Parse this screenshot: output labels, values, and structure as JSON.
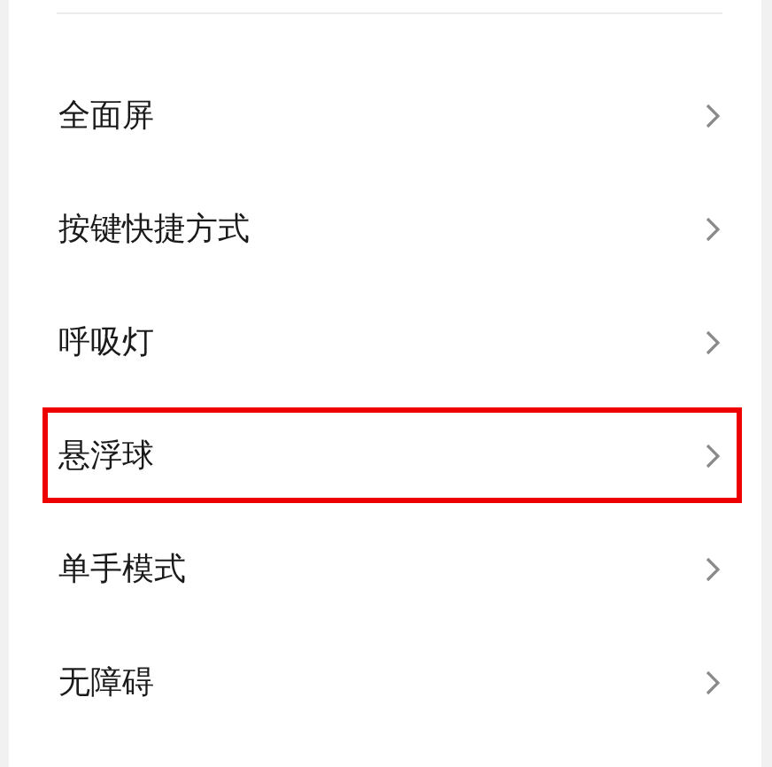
{
  "settings_list": [
    {
      "label": "全面屏",
      "highlighted": false
    },
    {
      "label": "按键快捷方式",
      "highlighted": false
    },
    {
      "label": "呼吸灯",
      "highlighted": false
    },
    {
      "label": "悬浮球",
      "highlighted": true
    },
    {
      "label": "单手模式",
      "highlighted": false
    },
    {
      "label": "无障碍",
      "highlighted": false
    }
  ]
}
